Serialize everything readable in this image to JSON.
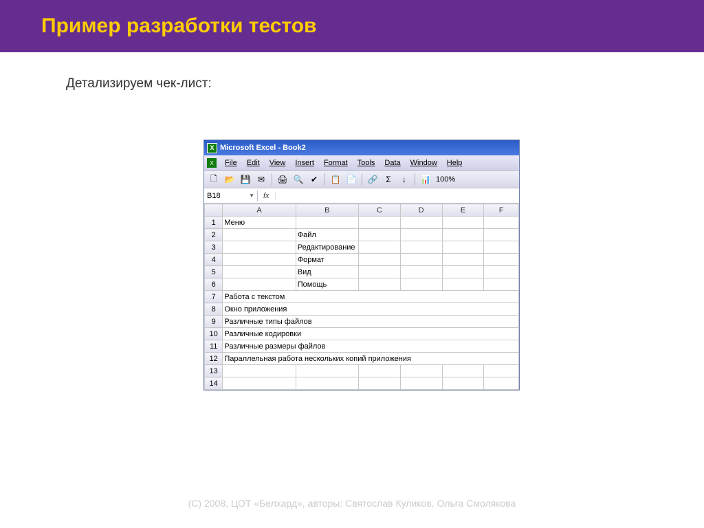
{
  "slide": {
    "title": "Пример разработки тестов",
    "subtitle": "Детализируем чек-лист:",
    "footer": "(С) 2008, ЦОТ «Белхард», авторы: Святослав Куликов, Ольга Смолякова"
  },
  "excel": {
    "title": "Microsoft Excel - Book2",
    "logo_letter": "X",
    "menu": [
      "File",
      "Edit",
      "View",
      "Insert",
      "Format",
      "Tools",
      "Data",
      "Window",
      "Help"
    ],
    "zoom": "100%",
    "namebox": "B18",
    "fx_label": "fx",
    "columns": [
      "A",
      "B",
      "C",
      "D",
      "E",
      "F"
    ],
    "rows": [
      {
        "n": "1",
        "a": "Меню",
        "b": "",
        "c": "",
        "d": "",
        "e": "",
        "f": ""
      },
      {
        "n": "2",
        "a": "",
        "b": "Файл",
        "c": "",
        "d": "",
        "e": "",
        "f": ""
      },
      {
        "n": "3",
        "a": "",
        "b": "Редактирование",
        "c": "",
        "d": "",
        "e": "",
        "f": ""
      },
      {
        "n": "4",
        "a": "",
        "b": "Формат",
        "c": "",
        "d": "",
        "e": "",
        "f": ""
      },
      {
        "n": "5",
        "a": "",
        "b": "Вид",
        "c": "",
        "d": "",
        "e": "",
        "f": ""
      },
      {
        "n": "6",
        "a": "",
        "b": "Помощь",
        "c": "",
        "d": "",
        "e": "",
        "f": ""
      },
      {
        "n": "7",
        "a": "Работа с текстом",
        "b": "",
        "c": "",
        "d": "",
        "e": "",
        "f": ""
      },
      {
        "n": "8",
        "a": "Окно приложения",
        "b": "",
        "c": "",
        "d": "",
        "e": "",
        "f": ""
      },
      {
        "n": "9",
        "a": "Различные типы файлов",
        "b": "",
        "c": "",
        "d": "",
        "e": "",
        "f": ""
      },
      {
        "n": "10",
        "a": "Различные кодировки",
        "b": "",
        "c": "",
        "d": "",
        "e": "",
        "f": ""
      },
      {
        "n": "11",
        "a": "Различные размеры файлов",
        "b": "",
        "c": "",
        "d": "",
        "e": "",
        "f": ""
      },
      {
        "n": "12",
        "a": "Параллельная работа нескольких копий приложения",
        "b": "",
        "c": "",
        "d": "",
        "e": "",
        "f": ""
      },
      {
        "n": "13",
        "a": "",
        "b": "",
        "c": "",
        "d": "",
        "e": "",
        "f": ""
      },
      {
        "n": "14",
        "a": "",
        "b": "",
        "c": "",
        "d": "",
        "e": "",
        "f": ""
      }
    ]
  }
}
